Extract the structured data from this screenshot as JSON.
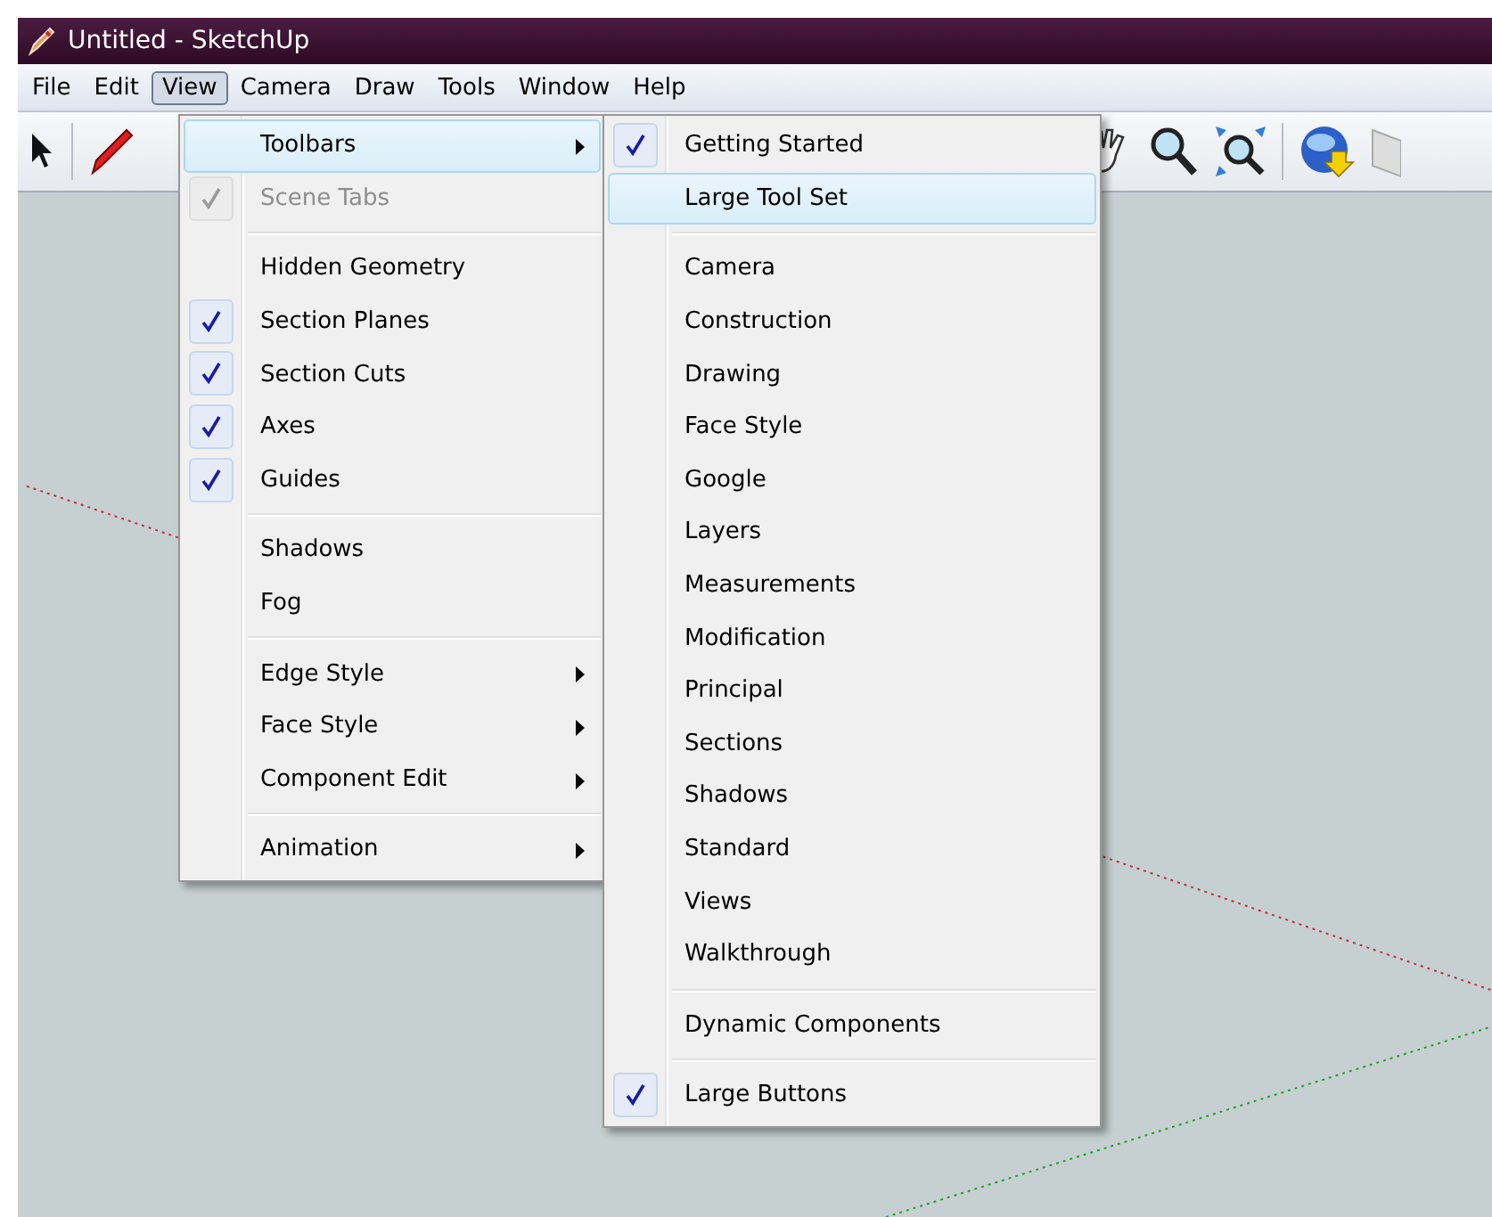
{
  "window": {
    "title": "Untitled - SketchUp"
  },
  "menu_bar": [
    {
      "label": "File",
      "selected": false
    },
    {
      "label": "Edit",
      "selected": false
    },
    {
      "label": "View",
      "selected": true
    },
    {
      "label": "Camera",
      "selected": false
    },
    {
      "label": "Draw",
      "selected": false
    },
    {
      "label": "Tools",
      "selected": false
    },
    {
      "label": "Window",
      "selected": false
    },
    {
      "label": "Help",
      "selected": false
    }
  ],
  "view_menu": [
    {
      "kind": "item",
      "label": "Toolbars",
      "checked": false,
      "disabled": false,
      "submenu": true,
      "selected": true
    },
    {
      "kind": "item",
      "label": "Scene Tabs",
      "checked": true,
      "disabled": true,
      "submenu": false,
      "selected": false
    },
    {
      "kind": "separator"
    },
    {
      "kind": "item",
      "label": "Hidden Geometry",
      "checked": false,
      "disabled": false,
      "submenu": false,
      "selected": false
    },
    {
      "kind": "item",
      "label": "Section Planes",
      "checked": true,
      "disabled": false,
      "submenu": false,
      "selected": false
    },
    {
      "kind": "item",
      "label": "Section Cuts",
      "checked": true,
      "disabled": false,
      "submenu": false,
      "selected": false
    },
    {
      "kind": "item",
      "label": "Axes",
      "checked": true,
      "disabled": false,
      "submenu": false,
      "selected": false
    },
    {
      "kind": "item",
      "label": "Guides",
      "checked": true,
      "disabled": false,
      "submenu": false,
      "selected": false
    },
    {
      "kind": "separator"
    },
    {
      "kind": "item",
      "label": "Shadows",
      "checked": false,
      "disabled": false,
      "submenu": false,
      "selected": false
    },
    {
      "kind": "item",
      "label": "Fog",
      "checked": false,
      "disabled": false,
      "submenu": false,
      "selected": false
    },
    {
      "kind": "separator"
    },
    {
      "kind": "item",
      "label": "Edge Style",
      "checked": false,
      "disabled": false,
      "submenu": true,
      "selected": false
    },
    {
      "kind": "item",
      "label": "Face Style",
      "checked": false,
      "disabled": false,
      "submenu": true,
      "selected": false
    },
    {
      "kind": "item",
      "label": "Component Edit",
      "checked": false,
      "disabled": false,
      "submenu": true,
      "selected": false
    },
    {
      "kind": "separator"
    },
    {
      "kind": "item",
      "label": "Animation",
      "checked": false,
      "disabled": false,
      "submenu": true,
      "selected": false
    }
  ],
  "toolbars_submenu": [
    {
      "kind": "item",
      "label": "Getting Started",
      "checked": true,
      "disabled": false,
      "submenu": false,
      "selected": false
    },
    {
      "kind": "item",
      "label": "Large Tool Set",
      "checked": false,
      "disabled": false,
      "submenu": false,
      "selected": true
    },
    {
      "kind": "separator"
    },
    {
      "kind": "item",
      "label": "Camera",
      "checked": false,
      "disabled": false,
      "submenu": false,
      "selected": false
    },
    {
      "kind": "item",
      "label": "Construction",
      "checked": false,
      "disabled": false,
      "submenu": false,
      "selected": false
    },
    {
      "kind": "item",
      "label": "Drawing",
      "checked": false,
      "disabled": false,
      "submenu": false,
      "selected": false
    },
    {
      "kind": "item",
      "label": "Face Style",
      "checked": false,
      "disabled": false,
      "submenu": false,
      "selected": false
    },
    {
      "kind": "item",
      "label": "Google",
      "checked": false,
      "disabled": false,
      "submenu": false,
      "selected": false
    },
    {
      "kind": "item",
      "label": "Layers",
      "checked": false,
      "disabled": false,
      "submenu": false,
      "selected": false
    },
    {
      "kind": "item",
      "label": "Measurements",
      "checked": false,
      "disabled": false,
      "submenu": false,
      "selected": false
    },
    {
      "kind": "item",
      "label": "Modification",
      "checked": false,
      "disabled": false,
      "submenu": false,
      "selected": false
    },
    {
      "kind": "item",
      "label": "Principal",
      "checked": false,
      "disabled": false,
      "submenu": false,
      "selected": false
    },
    {
      "kind": "item",
      "label": "Sections",
      "checked": false,
      "disabled": false,
      "submenu": false,
      "selected": false
    },
    {
      "kind": "item",
      "label": "Shadows",
      "checked": false,
      "disabled": false,
      "submenu": false,
      "selected": false
    },
    {
      "kind": "item",
      "label": "Standard",
      "checked": false,
      "disabled": false,
      "submenu": false,
      "selected": false
    },
    {
      "kind": "item",
      "label": "Views",
      "checked": false,
      "disabled": false,
      "submenu": false,
      "selected": false
    },
    {
      "kind": "item",
      "label": "Walkthrough",
      "checked": false,
      "disabled": false,
      "submenu": false,
      "selected": false
    },
    {
      "kind": "separator"
    },
    {
      "kind": "item",
      "label": "Dynamic Components",
      "checked": false,
      "disabled": false,
      "submenu": false,
      "selected": false
    },
    {
      "kind": "separator"
    },
    {
      "kind": "item",
      "label": "Large Buttons",
      "checked": true,
      "disabled": false,
      "submenu": false,
      "selected": false
    }
  ]
}
